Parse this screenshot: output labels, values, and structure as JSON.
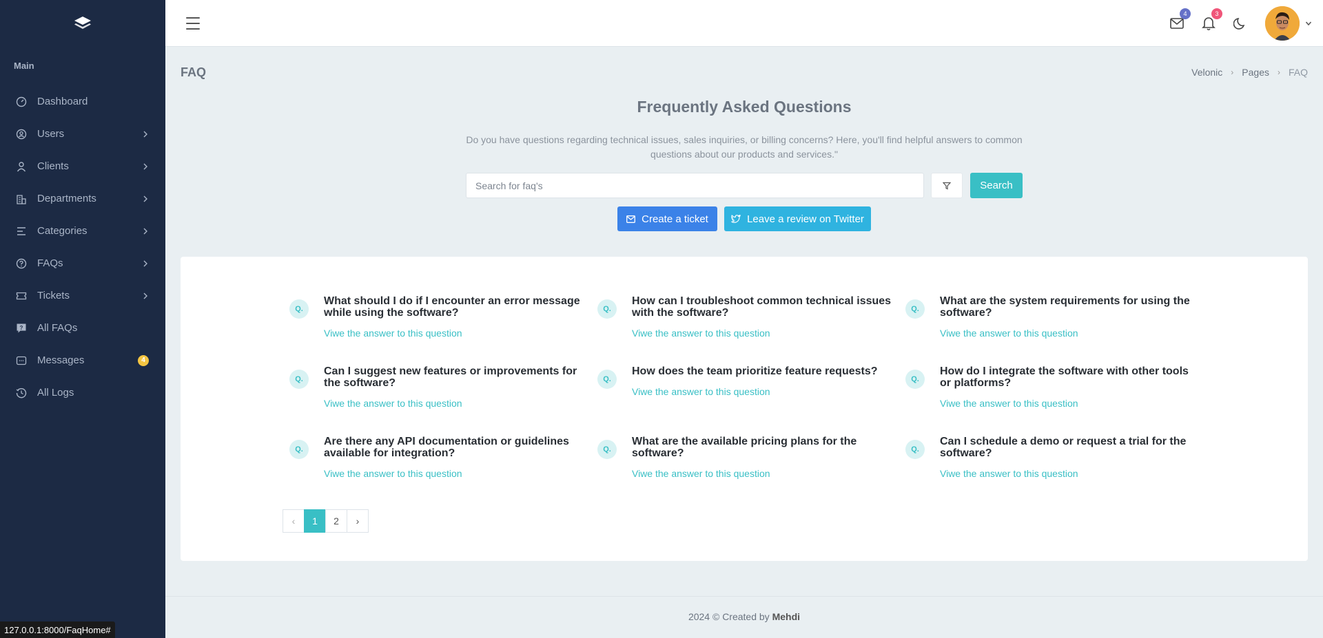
{
  "sidebar": {
    "section_title": "Main",
    "items": [
      {
        "label": "Dashboard",
        "icon": "dashboard-icon",
        "has_chevron": false
      },
      {
        "label": "Users",
        "icon": "users-icon",
        "has_chevron": true
      },
      {
        "label": "Clients",
        "icon": "user-icon",
        "has_chevron": true
      },
      {
        "label": "Departments",
        "icon": "building-icon",
        "has_chevron": true
      },
      {
        "label": "Categories",
        "icon": "list-icon",
        "has_chevron": true
      },
      {
        "label": "FAQs",
        "icon": "question-circle-icon",
        "has_chevron": true
      },
      {
        "label": "Tickets",
        "icon": "ticket-icon",
        "has_chevron": true
      },
      {
        "label": "All FAQs",
        "icon": "message-question-icon",
        "has_chevron": false
      },
      {
        "label": "Messages",
        "icon": "message-icon",
        "has_chevron": false,
        "badge": "4"
      },
      {
        "label": "All Logs",
        "icon": "history-icon",
        "has_chevron": false
      }
    ]
  },
  "topbar": {
    "mail_badge": "4",
    "notification_badge": "3",
    "mail_badge_color": "#6571c8",
    "notification_badge_color": "#f05579"
  },
  "page": {
    "title": "FAQ",
    "breadcrumb": [
      "Velonic",
      "Pages",
      "FAQ"
    ]
  },
  "hero": {
    "title": "Frequently Asked Questions",
    "subtitle": "Do you have questions regarding technical issues, sales inquiries, or billing concerns? Here, you'll find helpful answers to common questions about our products and services.\"",
    "search_placeholder": "Search for faq's",
    "search_button": "Search",
    "ticket_button": "Create a ticket",
    "twitter_button": "Leave a review on Twitter"
  },
  "faqs": {
    "badge": "Q.",
    "link_text": "Viwe the answer to this question",
    "items": [
      "What should I do if I encounter an error message while using the software?",
      "How can I troubleshoot common technical issues with the software?",
      "What are the system requirements for using the software?",
      "Can I suggest new features or improvements for the software?",
      "How does the team prioritize feature requests?",
      "How do I integrate the software with other tools or platforms?",
      "Are there any API documentation or guidelines available for integration?",
      "What are the available pricing plans for the software?",
      "Can I schedule a demo or request a trial for the software?"
    ]
  },
  "pagination": {
    "prev": "‹",
    "pages": [
      "1",
      "2"
    ],
    "active": "1",
    "next": "›"
  },
  "footer": {
    "text": "2024 © Created by",
    "author": "Mehdi"
  },
  "status_url": "127.0.0.1:8000/FaqHome#",
  "colors": {
    "sidebar": "#1c2a44",
    "accent": "#39bfc5",
    "primary": "#3b82e8",
    "twitter": "#2fb3e0",
    "background": "#e9eff2"
  }
}
